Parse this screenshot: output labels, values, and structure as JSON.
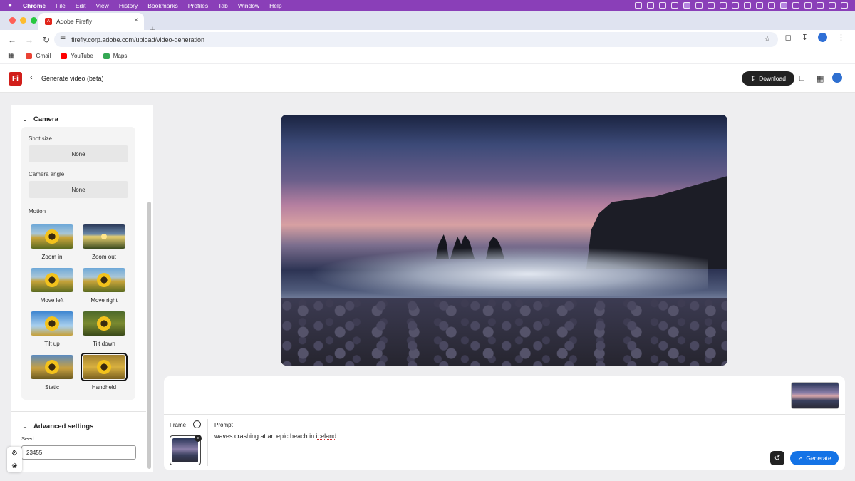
{
  "menubar": {
    "apple": "",
    "items": [
      "Chrome",
      "File",
      "Edit",
      "View",
      "History",
      "Bookmarks",
      "Profiles",
      "Tab",
      "Window",
      "Help"
    ]
  },
  "browser": {
    "tab_title": "Adobe Firefly",
    "tab_favicon": "A",
    "url": "firefly.corp.adobe.com/upload/video-generation",
    "bookmarks": [
      "Gmail",
      "YouTube",
      "Maps"
    ]
  },
  "header": {
    "logo": "Fi",
    "title": "Generate video (beta)",
    "download_label": "Download"
  },
  "camera": {
    "section_title": "Camera",
    "shot_size_label": "Shot size",
    "shot_size_value": "None",
    "camera_angle_label": "Camera angle",
    "camera_angle_value": "None",
    "motion_label": "Motion",
    "motions": [
      {
        "label": "Zoom in"
      },
      {
        "label": "Zoom out"
      },
      {
        "label": "Move left"
      },
      {
        "label": "Move right"
      },
      {
        "label": "Tilt up"
      },
      {
        "label": "Tilt down"
      },
      {
        "label": "Static"
      },
      {
        "label": "Handheld"
      }
    ],
    "selected_motion": "Handheld"
  },
  "advanced": {
    "section_title": "Advanced settings",
    "seed_label": "Seed",
    "seed_value": "23455"
  },
  "prompt": {
    "frame_label": "Frame",
    "prompt_label": "Prompt",
    "text_before": "waves crashing at an epic beach in ",
    "text_spell": "iceland",
    "generate_label": "Generate"
  },
  "colors": {
    "menubar": "#8a3fb8",
    "accent": "#1473e6",
    "brand": "#d11e1a"
  }
}
